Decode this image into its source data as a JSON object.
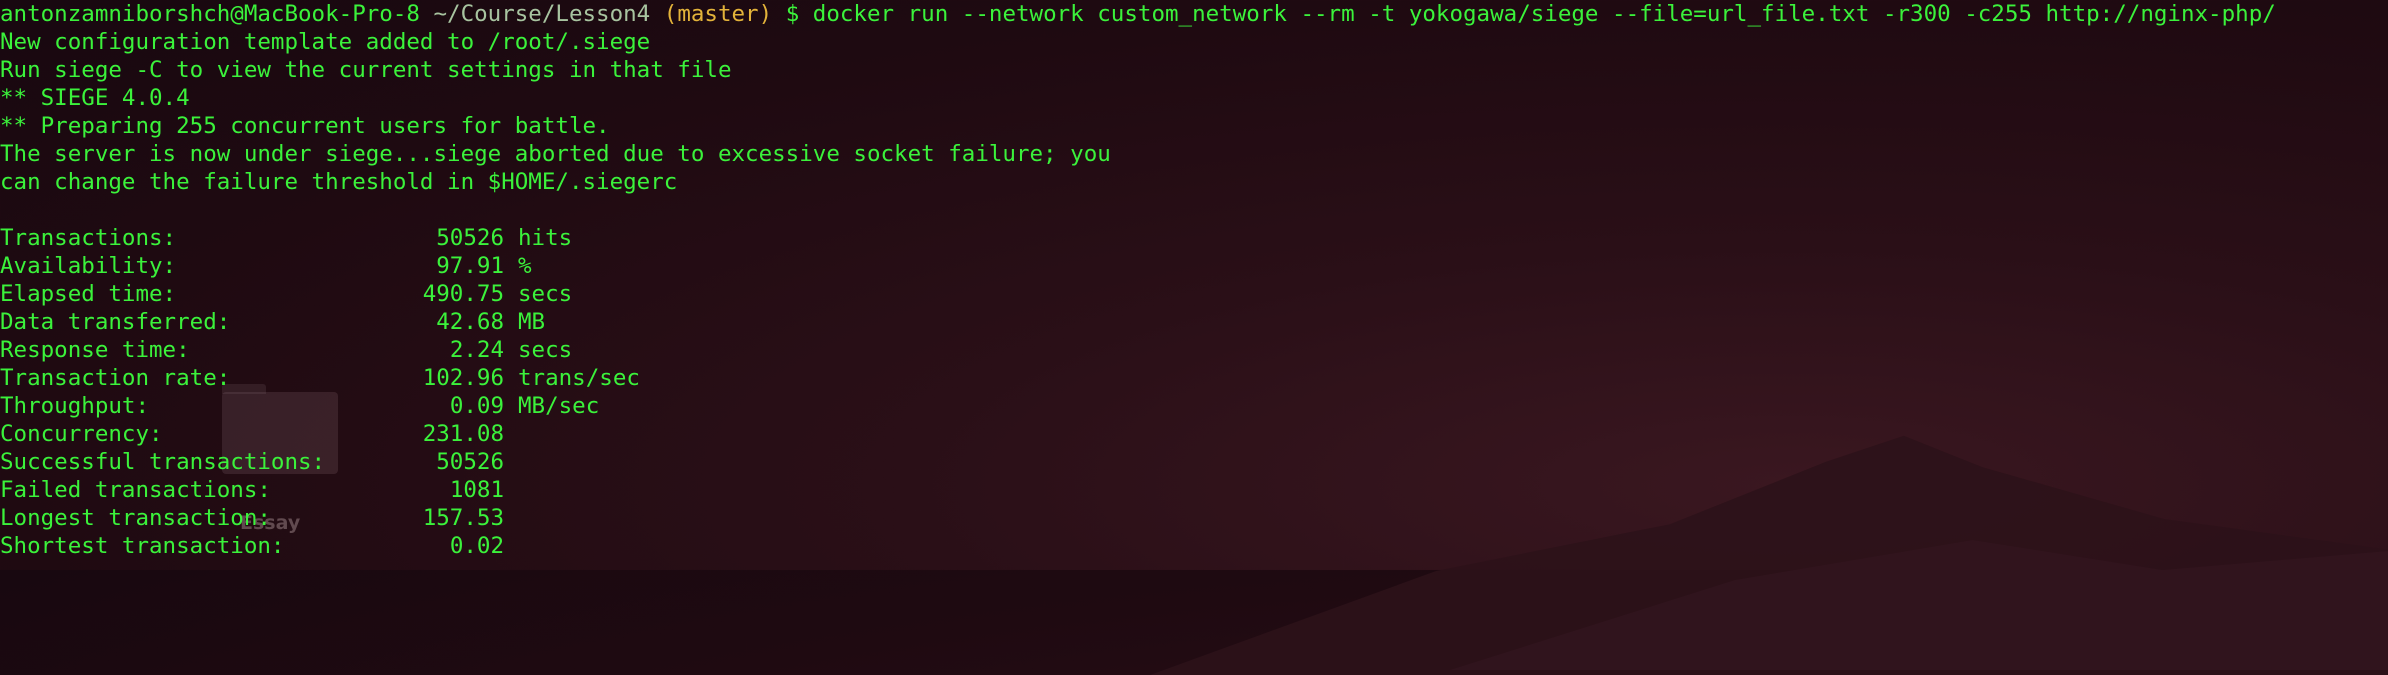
{
  "prompt": {
    "user_host": "antonzamniborshch@MacBook-Pro-8",
    "cwd": "~/Course/Lesson4",
    "branch": "(master)",
    "symbol": "$",
    "command": "docker run --network custom_network --rm -t yokogawa/siege --file=url_file.txt -r300 -c255 http://nginx-php/"
  },
  "output_lines": [
    "New configuration template added to /root/.siege",
    "Run siege -C to view the current settings in that file",
    "** SIEGE 4.0.4",
    "** Preparing 255 concurrent users for battle.",
    "The server is now under siege...siege aborted due to excessive socket failure; you",
    "can change the failure threshold in $HOME/.siegerc"
  ],
  "stats": [
    {
      "label": "Transactions:",
      "value": "50526",
      "unit": "hits"
    },
    {
      "label": "Availability:",
      "value": "97.91",
      "unit": "%"
    },
    {
      "label": "Elapsed time:",
      "value": "490.75",
      "unit": "secs"
    },
    {
      "label": "Data transferred:",
      "value": "42.68",
      "unit": "MB"
    },
    {
      "label": "Response time:",
      "value": "2.24",
      "unit": "secs"
    },
    {
      "label": "Transaction rate:",
      "value": "102.96",
      "unit": "trans/sec"
    },
    {
      "label": "Throughput:",
      "value": "0.09",
      "unit": "MB/sec"
    },
    {
      "label": "Concurrency:",
      "value": "231.08",
      "unit": ""
    },
    {
      "label": "Successful transactions:",
      "value": "50526",
      "unit": ""
    },
    {
      "label": "Failed transactions:",
      "value": "1081",
      "unit": ""
    },
    {
      "label": "Longest transaction:",
      "value": "157.53",
      "unit": ""
    },
    {
      "label": "Shortest transaction:",
      "value": "0.02",
      "unit": ""
    }
  ],
  "desktop": {
    "folder_label": "Essay",
    "folder_icon": "folder-icon"
  },
  "colors": {
    "text_green": "#3bf23b",
    "path_gray": "#a8c4a0",
    "branch_yellow": "#e3b33a",
    "background": "#1f0a11"
  }
}
